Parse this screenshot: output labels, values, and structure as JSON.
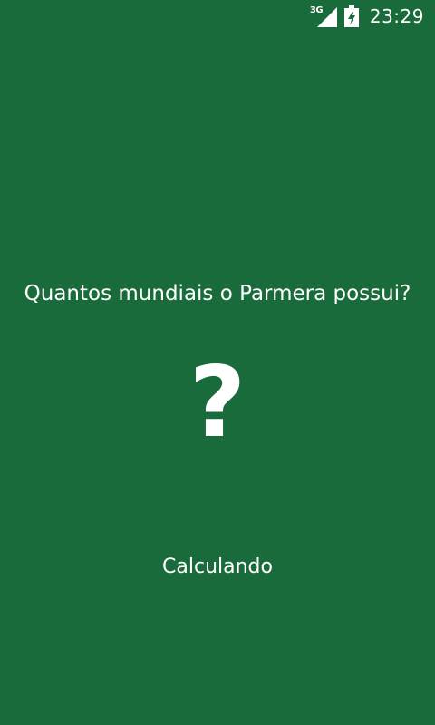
{
  "status_bar": {
    "network_type": "3G",
    "time": "23:29",
    "icons": [
      "signal-icon",
      "battery-charging-icon"
    ]
  },
  "main": {
    "question": "Quantos mundiais o Parmera possui?",
    "answer_symbol": "?",
    "status": "Calculando"
  },
  "colors": {
    "background": "#1a6b3b",
    "text": "#ffffff"
  }
}
